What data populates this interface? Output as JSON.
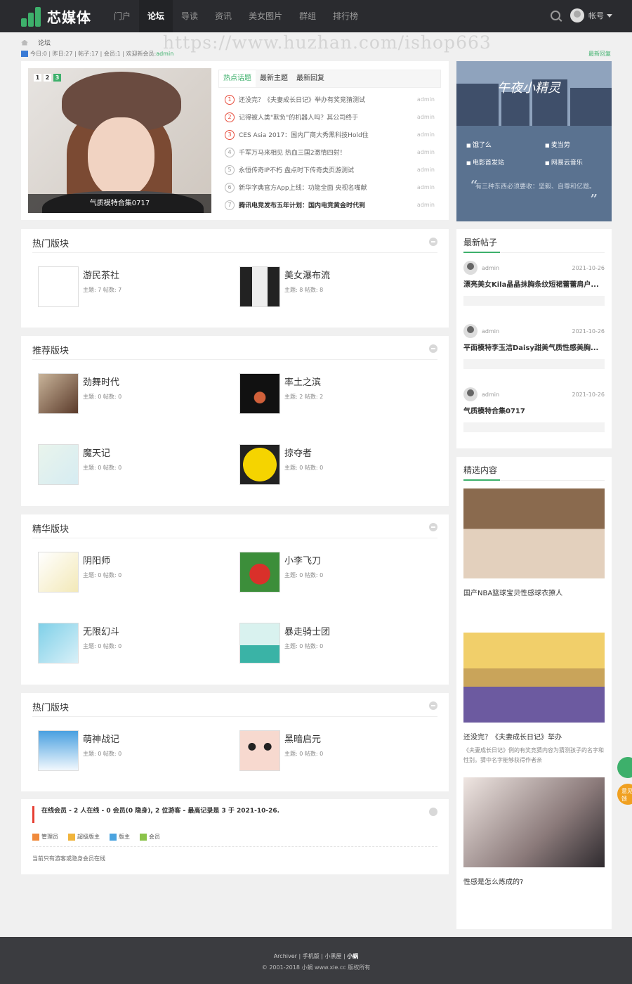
{
  "header": {
    "brand": "芯媒体",
    "nav": [
      "门户",
      "论坛",
      "导读",
      "资讯",
      "美女图片",
      "群组",
      "排行榜"
    ],
    "nav_active": "论坛",
    "account_label": "帐号"
  },
  "watermark": "https://www.huzhan.com/ishop663",
  "breadcrumb": {
    "current": "论坛"
  },
  "stats": {
    "today_label": "今日: ",
    "today": "0",
    "yesterday_label": "昨日: ",
    "yesterday": "27",
    "posts_label": "帖子: ",
    "posts": "17",
    "members_label": "会员: ",
    "members": "1",
    "welcome_label": "欢迎新会员: ",
    "welcome_user": "admin"
  },
  "latest_replies_link": "最新回复",
  "slider": {
    "pages": [
      "1",
      "2",
      "3"
    ],
    "active_page": "3",
    "caption": "气质模特合集0717"
  },
  "hot_tabs": [
    "热点话题",
    "最新主题",
    "最新回复"
  ],
  "hot_topics": [
    {
      "n": "1",
      "title": "还没完？《夫妻成长日记》举办有奖竞猜测试",
      "author": "admin"
    },
    {
      "n": "2",
      "title": "记得被人类\"欺负\"的机器人吗？其公司终于",
      "author": "admin"
    },
    {
      "n": "3",
      "title": "CES Asia 2017：国内厂商大秀黑科技Hold住",
      "author": "admin"
    },
    {
      "n": "4",
      "title": "千军万马来相见 热血三国2激情四射！",
      "author": "admin"
    },
    {
      "n": "5",
      "title": "永恒传奇IP不朽 盘点时下传奇类页游测试",
      "author": "admin"
    },
    {
      "n": "6",
      "title": "新华字典官方App上线：功能全面 央视名嘴献",
      "author": "admin"
    },
    {
      "n": "7",
      "title": "腾讯电竞发布五年计划：国内电竞黄金时代到",
      "author": "admin"
    }
  ],
  "promo": {
    "title": "午夜小精灵",
    "links": [
      "饿了么",
      "麦当劳",
      "电影首发站",
      "网易云音乐"
    ],
    "quote": "有三种东西必须要收：坚毅、自尊和亿题。"
  },
  "sections": [
    {
      "title": "热门版块",
      "forums": [
        {
          "name": "游民茶社",
          "meta": "主题: 7 帖数: 7"
        },
        {
          "name": "美女瀑布流",
          "meta": "主题: 8 帖数: 8"
        }
      ]
    },
    {
      "title": "推荐版块",
      "forums": [
        {
          "name": "劲舞时代",
          "meta": "主题: 0 帖数: 0"
        },
        {
          "name": "率土之滨",
          "meta": "主题: 2 帖数: 2"
        },
        {
          "name": "魔天记",
          "meta": "主题: 0 帖数: 0"
        },
        {
          "name": "掠夺者",
          "meta": "主题: 0 帖数: 0"
        }
      ]
    },
    {
      "title": "精华版块",
      "forums": [
        {
          "name": "阴阳师",
          "meta": "主题: 0 帖数: 0"
        },
        {
          "name": "小李飞刀",
          "meta": "主题: 0 帖数: 0"
        },
        {
          "name": "无限幻斗",
          "meta": "主题: 0 帖数: 0"
        },
        {
          "name": "暴走骑士团",
          "meta": "主题: 0 帖数: 0"
        }
      ]
    },
    {
      "title": "热门版块",
      "forums": [
        {
          "name": "萌神战记",
          "meta": "主题: 0 帖数: 0"
        },
        {
          "name": "黑暗启元",
          "meta": "主题: 0 帖数: 0"
        }
      ]
    }
  ],
  "online": {
    "summary": "在线会员 - 2 人在线 - 0 会员(0 隐身), 2 位游客 - 最高记录是 3 于 2021-10-26.",
    "legend": [
      "管理员",
      "超级版主",
      "版主",
      "会员"
    ],
    "legend_colors": [
      "#f08a3c",
      "#f0b43c",
      "#4aa3df",
      "#8bc34a"
    ],
    "empty": "当前只有游客或隐身会员在线"
  },
  "new_posts": {
    "title": "最新帖子",
    "items": [
      {
        "author": "admin",
        "date": "2021-10-26",
        "title": "漂亮美女Kila晶晶抹胸条纹短裙蕾蕾肩户..."
      },
      {
        "author": "admin",
        "date": "2021-10-26",
        "title": "平面模特李玉洁Daisy甜美气质性感美胸..."
      },
      {
        "author": "admin",
        "date": "2021-10-26",
        "title": "气质模特合集0717"
      }
    ]
  },
  "picks": {
    "title": "精选内容",
    "items": [
      {
        "title": "国产NBA篮球宝贝性感球衣撩人",
        "desc": ""
      },
      {
        "title": "还没完？《夫妻成长日记》举办",
        "desc": "《夫妻成长日记》例的有奖竞猜内容为猜测孩子的名字和性别。猜中名字能够获得作者亲"
      },
      {
        "title": "性感是怎么炼成的?",
        "desc": ""
      }
    ]
  },
  "footer": {
    "links": [
      "Archiver",
      "手机版",
      "小黑屋",
      "小蜗"
    ],
    "copyright": "© 2001-2018 小蜗 www.xie.cc 版权所有"
  },
  "float": {
    "feedback": "意见反馈"
  }
}
